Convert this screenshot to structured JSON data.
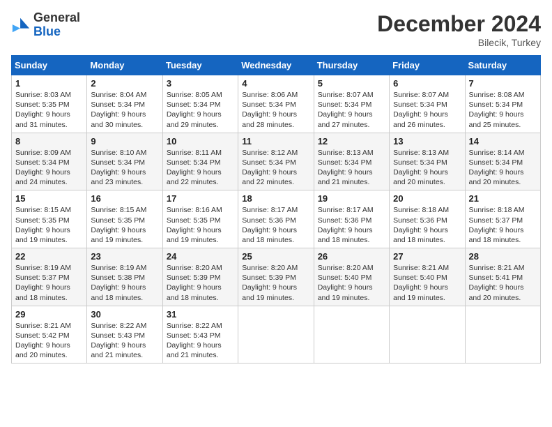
{
  "header": {
    "logo_general": "General",
    "logo_blue": "Blue",
    "month_year": "December 2024",
    "location": "Bilecik, Turkey"
  },
  "days_of_week": [
    "Sunday",
    "Monday",
    "Tuesday",
    "Wednesday",
    "Thursday",
    "Friday",
    "Saturday"
  ],
  "weeks": [
    [
      {
        "day": "1",
        "sunrise": "Sunrise: 8:03 AM",
        "sunset": "Sunset: 5:35 PM",
        "daylight": "Daylight: 9 hours and 31 minutes."
      },
      {
        "day": "2",
        "sunrise": "Sunrise: 8:04 AM",
        "sunset": "Sunset: 5:34 PM",
        "daylight": "Daylight: 9 hours and 30 minutes."
      },
      {
        "day": "3",
        "sunrise": "Sunrise: 8:05 AM",
        "sunset": "Sunset: 5:34 PM",
        "daylight": "Daylight: 9 hours and 29 minutes."
      },
      {
        "day": "4",
        "sunrise": "Sunrise: 8:06 AM",
        "sunset": "Sunset: 5:34 PM",
        "daylight": "Daylight: 9 hours and 28 minutes."
      },
      {
        "day": "5",
        "sunrise": "Sunrise: 8:07 AM",
        "sunset": "Sunset: 5:34 PM",
        "daylight": "Daylight: 9 hours and 27 minutes."
      },
      {
        "day": "6",
        "sunrise": "Sunrise: 8:07 AM",
        "sunset": "Sunset: 5:34 PM",
        "daylight": "Daylight: 9 hours and 26 minutes."
      },
      {
        "day": "7",
        "sunrise": "Sunrise: 8:08 AM",
        "sunset": "Sunset: 5:34 PM",
        "daylight": "Daylight: 9 hours and 25 minutes."
      }
    ],
    [
      {
        "day": "8",
        "sunrise": "Sunrise: 8:09 AM",
        "sunset": "Sunset: 5:34 PM",
        "daylight": "Daylight: 9 hours and 24 minutes."
      },
      {
        "day": "9",
        "sunrise": "Sunrise: 8:10 AM",
        "sunset": "Sunset: 5:34 PM",
        "daylight": "Daylight: 9 hours and 23 minutes."
      },
      {
        "day": "10",
        "sunrise": "Sunrise: 8:11 AM",
        "sunset": "Sunset: 5:34 PM",
        "daylight": "Daylight: 9 hours and 22 minutes."
      },
      {
        "day": "11",
        "sunrise": "Sunrise: 8:12 AM",
        "sunset": "Sunset: 5:34 PM",
        "daylight": "Daylight: 9 hours and 22 minutes."
      },
      {
        "day": "12",
        "sunrise": "Sunrise: 8:13 AM",
        "sunset": "Sunset: 5:34 PM",
        "daylight": "Daylight: 9 hours and 21 minutes."
      },
      {
        "day": "13",
        "sunrise": "Sunrise: 8:13 AM",
        "sunset": "Sunset: 5:34 PM",
        "daylight": "Daylight: 9 hours and 20 minutes."
      },
      {
        "day": "14",
        "sunrise": "Sunrise: 8:14 AM",
        "sunset": "Sunset: 5:34 PM",
        "daylight": "Daylight: 9 hours and 20 minutes."
      }
    ],
    [
      {
        "day": "15",
        "sunrise": "Sunrise: 8:15 AM",
        "sunset": "Sunset: 5:35 PM",
        "daylight": "Daylight: 9 hours and 19 minutes."
      },
      {
        "day": "16",
        "sunrise": "Sunrise: 8:15 AM",
        "sunset": "Sunset: 5:35 PM",
        "daylight": "Daylight: 9 hours and 19 minutes."
      },
      {
        "day": "17",
        "sunrise": "Sunrise: 8:16 AM",
        "sunset": "Sunset: 5:35 PM",
        "daylight": "Daylight: 9 hours and 19 minutes."
      },
      {
        "day": "18",
        "sunrise": "Sunrise: 8:17 AM",
        "sunset": "Sunset: 5:36 PM",
        "daylight": "Daylight: 9 hours and 18 minutes."
      },
      {
        "day": "19",
        "sunrise": "Sunrise: 8:17 AM",
        "sunset": "Sunset: 5:36 PM",
        "daylight": "Daylight: 9 hours and 18 minutes."
      },
      {
        "day": "20",
        "sunrise": "Sunrise: 8:18 AM",
        "sunset": "Sunset: 5:36 PM",
        "daylight": "Daylight: 9 hours and 18 minutes."
      },
      {
        "day": "21",
        "sunrise": "Sunrise: 8:18 AM",
        "sunset": "Sunset: 5:37 PM",
        "daylight": "Daylight: 9 hours and 18 minutes."
      }
    ],
    [
      {
        "day": "22",
        "sunrise": "Sunrise: 8:19 AM",
        "sunset": "Sunset: 5:37 PM",
        "daylight": "Daylight: 9 hours and 18 minutes."
      },
      {
        "day": "23",
        "sunrise": "Sunrise: 8:19 AM",
        "sunset": "Sunset: 5:38 PM",
        "daylight": "Daylight: 9 hours and 18 minutes."
      },
      {
        "day": "24",
        "sunrise": "Sunrise: 8:20 AM",
        "sunset": "Sunset: 5:39 PM",
        "daylight": "Daylight: 9 hours and 18 minutes."
      },
      {
        "day": "25",
        "sunrise": "Sunrise: 8:20 AM",
        "sunset": "Sunset: 5:39 PM",
        "daylight": "Daylight: 9 hours and 19 minutes."
      },
      {
        "day": "26",
        "sunrise": "Sunrise: 8:20 AM",
        "sunset": "Sunset: 5:40 PM",
        "daylight": "Daylight: 9 hours and 19 minutes."
      },
      {
        "day": "27",
        "sunrise": "Sunrise: 8:21 AM",
        "sunset": "Sunset: 5:40 PM",
        "daylight": "Daylight: 9 hours and 19 minutes."
      },
      {
        "day": "28",
        "sunrise": "Sunrise: 8:21 AM",
        "sunset": "Sunset: 5:41 PM",
        "daylight": "Daylight: 9 hours and 20 minutes."
      }
    ],
    [
      {
        "day": "29",
        "sunrise": "Sunrise: 8:21 AM",
        "sunset": "Sunset: 5:42 PM",
        "daylight": "Daylight: 9 hours and 20 minutes."
      },
      {
        "day": "30",
        "sunrise": "Sunrise: 8:22 AM",
        "sunset": "Sunset: 5:43 PM",
        "daylight": "Daylight: 9 hours and 21 minutes."
      },
      {
        "day": "31",
        "sunrise": "Sunrise: 8:22 AM",
        "sunset": "Sunset: 5:43 PM",
        "daylight": "Daylight: 9 hours and 21 minutes."
      },
      null,
      null,
      null,
      null
    ]
  ]
}
